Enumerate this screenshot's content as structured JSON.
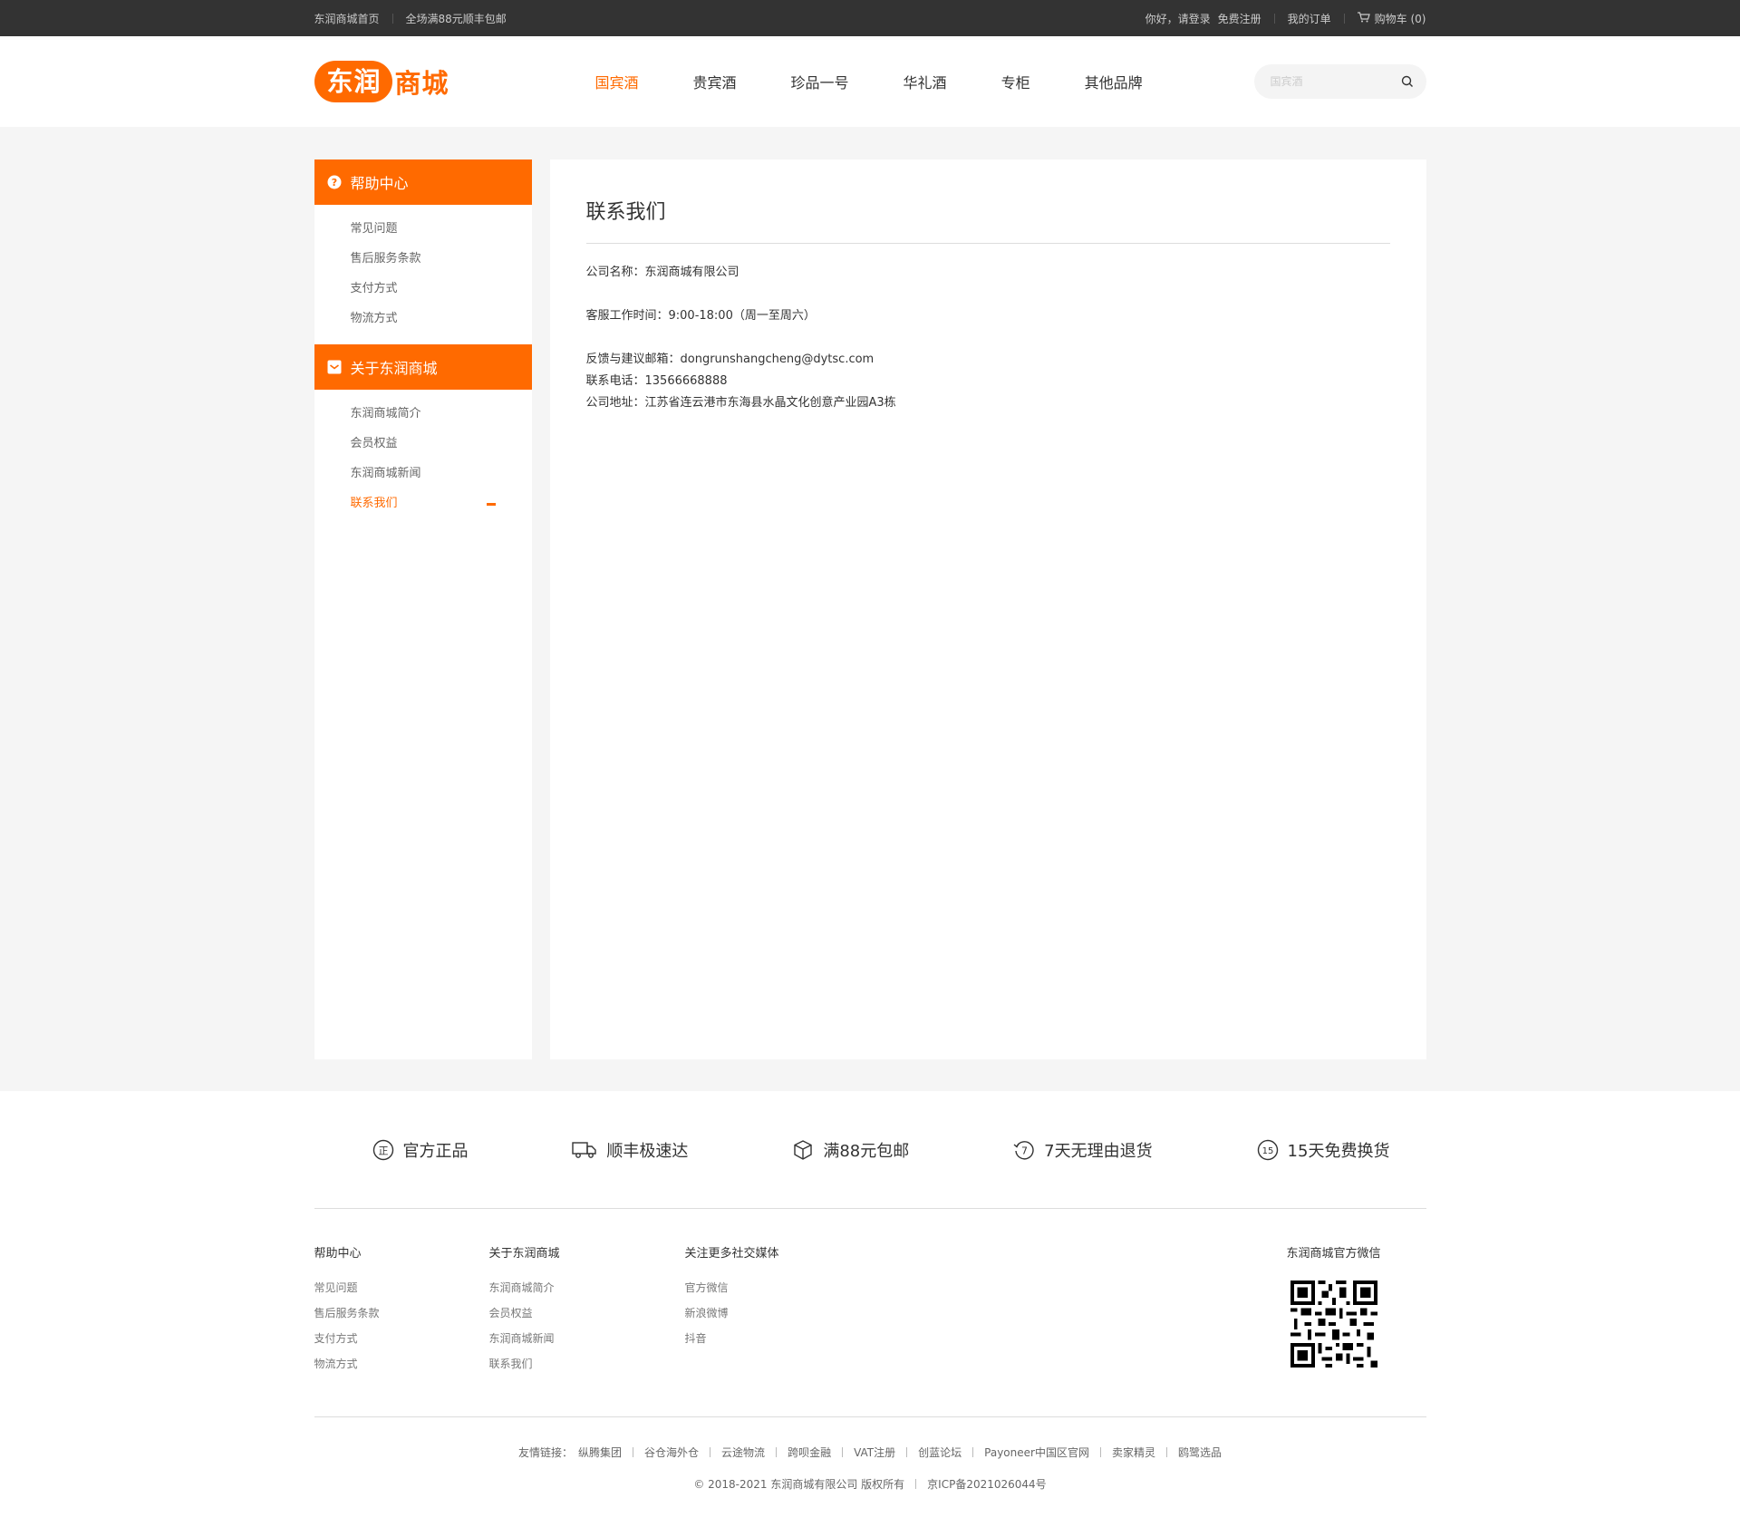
{
  "topbar": {
    "home": "东润商城首页",
    "shipping": "全场满88元顺丰包邮",
    "greeting": "你好，请登录",
    "register": "免费注册",
    "orders": "我的订单",
    "cart": "购物车 (0)"
  },
  "header": {
    "logo_part1": "东润",
    "logo_part2": "商城",
    "nav": [
      "国宾酒",
      "贵宾酒",
      "珍品一号",
      "华礼酒",
      "专柜",
      "其他品牌"
    ],
    "search_placeholder": "国宾酒"
  },
  "sidebar": {
    "help_title": "帮助中心",
    "help_items": [
      "常见问题",
      "售后服务条款",
      "支付方式",
      "物流方式"
    ],
    "about_title": "关于东润商城",
    "about_items": [
      "东润商城简介",
      "会员权益",
      "东润商城新闻",
      "联系我们"
    ]
  },
  "content": {
    "title": "联系我们",
    "company": "公司名称：东润商城有限公司",
    "hours": "客服工作时间：9:00-18:00（周一至周六）",
    "email": "反馈与建议邮箱：dongrunshangcheng@dytsc.com",
    "phone": "联系电话：13566668888",
    "address": "公司地址：江苏省连云港市东海县水晶文化创意产业园A3栋"
  },
  "services": [
    "官方正品",
    "顺丰极速达",
    "满88元包邮",
    "7天无理由退货",
    "15天免费换货"
  ],
  "footer": {
    "help_title": "帮助中心",
    "help_links": [
      "常见问题",
      "售后服务条款",
      "支付方式",
      "物流方式"
    ],
    "about_title": "关于东润商城",
    "about_links": [
      "东润商城简介",
      "会员权益",
      "东润商城新闻",
      "联系我们"
    ],
    "social_title": "关注更多社交媒体",
    "social_links": [
      "官方微信",
      "新浪微博",
      "抖音"
    ],
    "wechat_title": "东润商城官方微信",
    "friends_label": "友情链接：",
    "friends": [
      "纵腾集团",
      "谷仓海外仓",
      "云途物流",
      "跨呗金融",
      "VAT注册",
      "创蓝论坛",
      "Payoneer中国区官网",
      "卖家精灵",
      "鸥鹭选品"
    ],
    "copyright": "© 2018-2021 东润商城有限公司 版权所有",
    "icp": "京ICP备2021026044号"
  },
  "colors": {
    "accent": "#ff6a00",
    "topbar": "#333333",
    "background": "#f5f5f5"
  }
}
